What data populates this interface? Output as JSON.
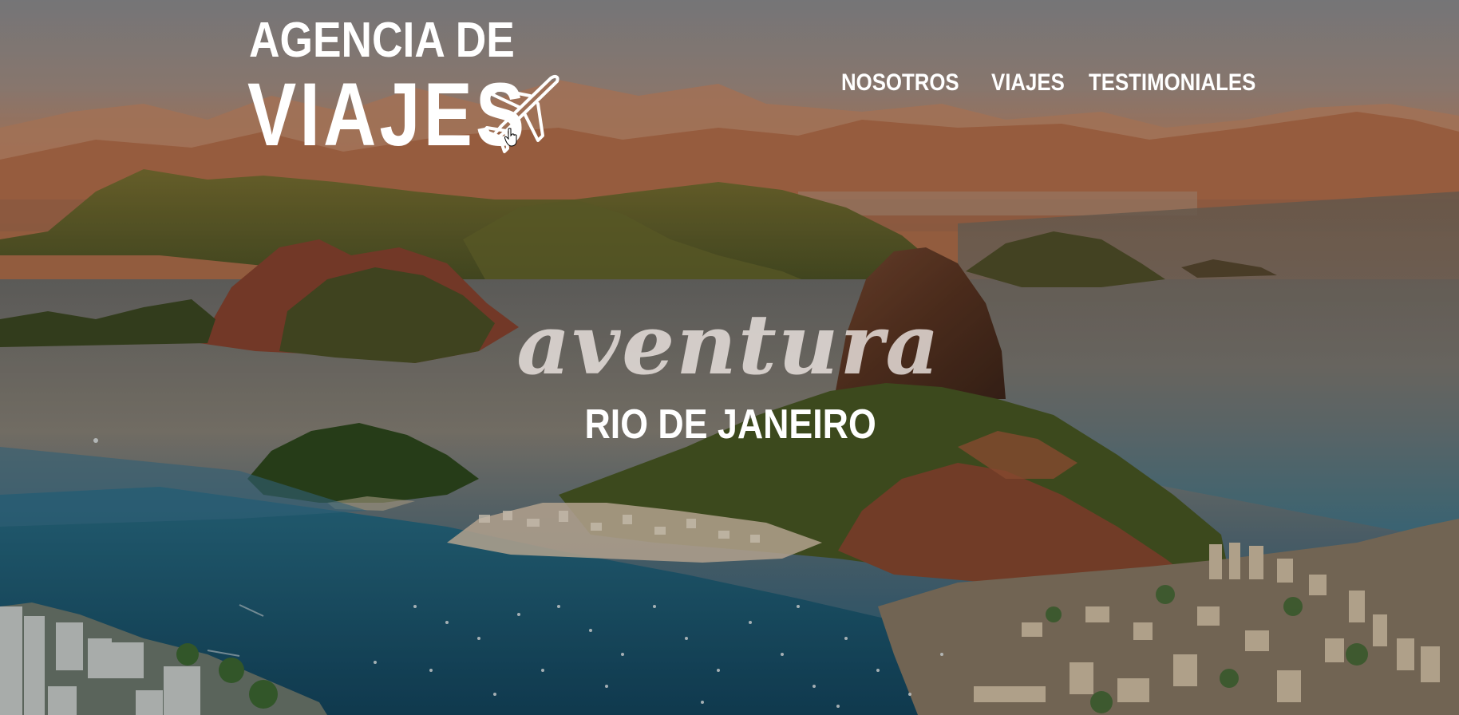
{
  "header": {
    "logo": {
      "line1": "AGENCIA DE",
      "line2": "VIAJES",
      "icon": "airplane-icon"
    },
    "nav": [
      {
        "label": "NOSOTROS"
      },
      {
        "label": "VIAJES"
      },
      {
        "label": "TESTIMONIALES"
      }
    ]
  },
  "hero": {
    "script_text": "aventura",
    "title": "RIO DE JANEIRO",
    "background": "rio-de-janeiro-sugarloaf-aerial-photo"
  },
  "colors": {
    "text": "#ffffff",
    "script": "#ebe4e1",
    "sky": "#c98a62",
    "water": "#1f5c7a"
  }
}
